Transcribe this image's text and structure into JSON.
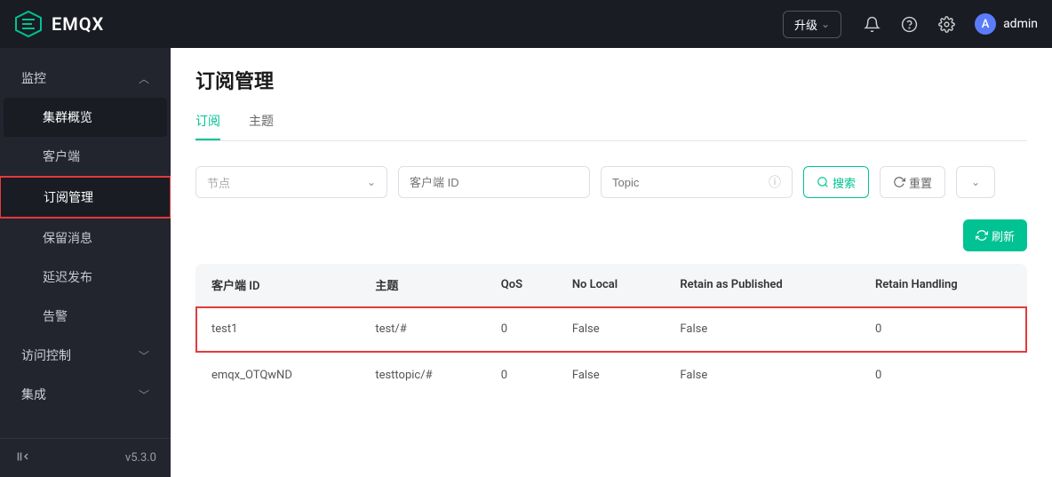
{
  "header": {
    "brand": "EMQX",
    "upgrade_label": "升级",
    "username": "admin",
    "avatar_letter": "A"
  },
  "sidebar": {
    "groups": [
      {
        "label": "监控",
        "expanded": true,
        "items": [
          {
            "label": "集群概览",
            "active": false,
            "highlight": true
          },
          {
            "label": "客户端",
            "active": false
          },
          {
            "label": "订阅管理",
            "active": true
          },
          {
            "label": "保留消息",
            "active": false
          },
          {
            "label": "延迟发布",
            "active": false
          },
          {
            "label": "告警",
            "active": false
          }
        ]
      },
      {
        "label": "访问控制",
        "expanded": false,
        "items": []
      },
      {
        "label": "集成",
        "expanded": false,
        "items": []
      }
    ],
    "version": "v5.3.0"
  },
  "page": {
    "title": "订阅管理",
    "tabs": [
      {
        "label": "订阅",
        "active": true
      },
      {
        "label": "主题",
        "active": false
      }
    ],
    "filters": {
      "node_placeholder": "节点",
      "client_placeholder": "客户端 ID",
      "topic_placeholder": "Topic",
      "search_label": "搜索",
      "reset_label": "重置"
    },
    "refresh_label": "刷新",
    "table": {
      "columns": [
        "客户端 ID",
        "主题",
        "QoS",
        "No Local",
        "Retain as Published",
        "Retain Handling"
      ],
      "rows": [
        {
          "cells": [
            "test1",
            "test/#",
            "0",
            "False",
            "False",
            "0"
          ],
          "highlighted": true
        },
        {
          "cells": [
            "emqx_OTQwND",
            "testtopic/#",
            "0",
            "False",
            "False",
            "0"
          ],
          "highlighted": false
        }
      ]
    }
  }
}
